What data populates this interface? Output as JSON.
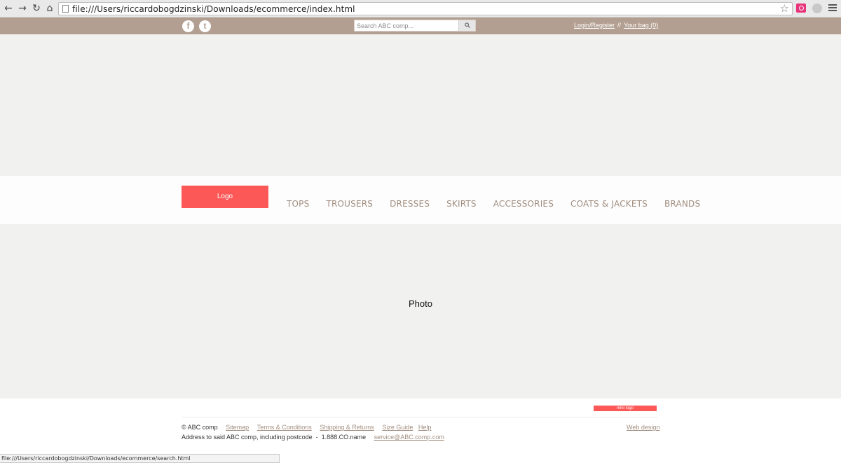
{
  "browser": {
    "url": "file:///Users/riccardobogdzinski/Downloads/ecommerce/index.html",
    "back_icon": "back-arrow-icon",
    "forward_icon": "forward-arrow-icon",
    "reload_icon": "reload-icon",
    "home_icon": "home-icon"
  },
  "topbar": {
    "facebook_glyph": "f",
    "twitter_glyph": "t",
    "search_placeholder": "Search ABC comp...",
    "login_label": "Login/Register",
    "separator": "//",
    "bag_label": "Your bag (0)",
    "color": "#b39f91"
  },
  "nav": {
    "logo_label": "Logo",
    "items": [
      "TOPS",
      "TROUSERS",
      "DRESSES",
      "SKIRTS",
      "ACCESSORIES",
      "COATS & JACKETS",
      "BRANDS"
    ]
  },
  "photo": {
    "label": "Photo"
  },
  "footer": {
    "mini_logo": "mini logo",
    "copyright": "© ABC comp",
    "links": [
      "Sitemap",
      "Terms & Conditions",
      "Shipping & Returns",
      "Size Guide",
      "Help"
    ],
    "address": "Address to said ABC comp, including postcode  -  1.888.CO.name",
    "email": "service@ABC.comp.com",
    "web_design": "Web design"
  },
  "statusbar": {
    "text": "file:///Users/riccardobogdzinski/Downloads/ecommerce/search.html"
  },
  "colors": {
    "accent": "#fc5858",
    "nav_text": "#a08d7f",
    "background": "#f1f1f0"
  }
}
